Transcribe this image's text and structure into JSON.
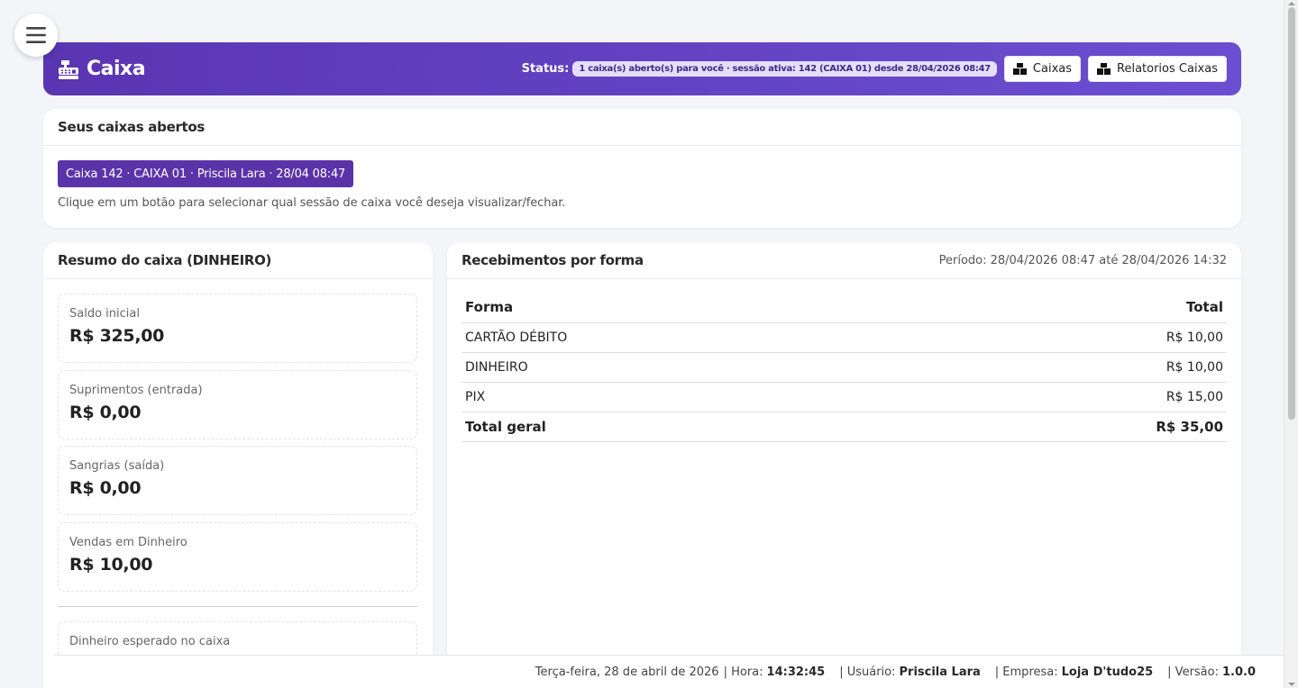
{
  "header": {
    "title": "Caixa",
    "status_label": "Status:",
    "status_text": "1 caixa(s) aberto(s) para você · sessão ativa: 142 (CAIXA 01) desde 28/04/2026 08:47",
    "btn_caixas": "Caixas",
    "btn_relatorios": "Relatorios Caixas"
  },
  "open_boxes": {
    "title": "Seus caixas abertos",
    "session_button": "Caixa 142 · CAIXA 01 · Priscila Lara · 28/04 08:47",
    "hint": "Clique em um botão para selecionar qual sessão de caixa você deseja visualizar/fechar."
  },
  "resumo": {
    "title": "Resumo do caixa (DINHEIRO)",
    "metrics": [
      {
        "label": "Saldo inicial",
        "value": "R$ 325,00"
      },
      {
        "label": "Suprimentos (entrada)",
        "value": "R$ 0,00"
      },
      {
        "label": "Sangrias (saída)",
        "value": "R$ 0,00"
      },
      {
        "label": "Vendas em Dinheiro",
        "value": "R$ 10,00"
      },
      {
        "label": "Dinheiro esperado no caixa",
        "value": ""
      }
    ]
  },
  "recebimentos": {
    "title": "Recebimentos por forma",
    "periodo": "Período: 28/04/2026 08:47 até 28/04/2026 14:32",
    "col_forma": "Forma",
    "col_total": "Total",
    "rows": [
      {
        "forma": "CARTÃO DÉBITO",
        "total": "R$ 10,00"
      },
      {
        "forma": "DINHEIRO",
        "total": "R$ 10,00"
      },
      {
        "forma": "PIX",
        "total": "R$ 15,00"
      }
    ],
    "total_label": "Total geral",
    "total_value": "R$ 35,00"
  },
  "footer": {
    "date": "Terça-feira, 28 de abril de 2026",
    "hora_label": "| Hora:",
    "hora": "14:32:45",
    "usuario_label": "| Usuário:",
    "usuario": "Priscila Lara",
    "empresa_label": "| Empresa:",
    "empresa": "Loja D'tudo25",
    "versao_label": "| Versão:",
    "versao": "1.0.0"
  },
  "icons": {
    "menu": "hamburger-icon",
    "brand": "cash-register-icon",
    "buttons": "boxes-icon"
  },
  "colors": {
    "header_start": "#5a35b2",
    "header_end": "#6b4fd1",
    "session_button": "#5b33a8",
    "status_badge_bg": "#e5defa"
  }
}
